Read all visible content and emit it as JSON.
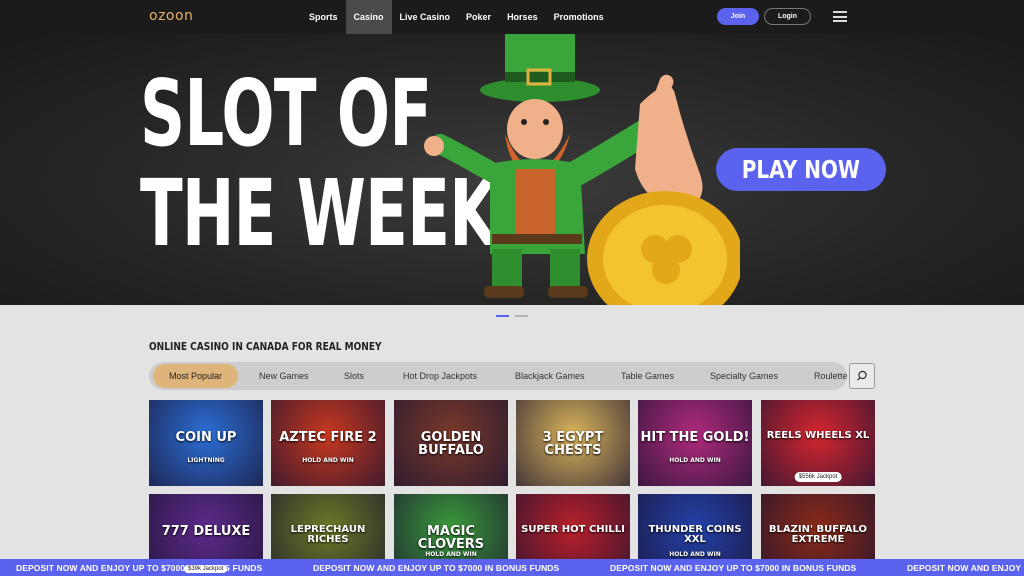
{
  "header": {
    "logo": "ozoon",
    "nav": [
      "Sports",
      "Casino",
      "Live Casino",
      "Poker",
      "Horses",
      "Promotions"
    ],
    "active_nav": "Casino",
    "join_label": "Join",
    "login_label": "Login",
    "menu_icon": "hamburger-icon"
  },
  "hero": {
    "title_line1": "SLOT OF",
    "title_line2": "THE WEEK",
    "cta_label": "PLAY NOW",
    "slides": 2,
    "active_slide": 1
  },
  "section": {
    "title": "ONLINE CASINO IN CANADA FOR REAL MONEY",
    "tabs": [
      "Most Popular",
      "New Games",
      "Slots",
      "Hot Drop Jackpots",
      "Blackjack Games",
      "Table Games",
      "Specialty Games",
      "Roulette"
    ],
    "active_tab": "Most Popular",
    "search_icon": "search-icon"
  },
  "games": [
    {
      "title": "COIN UP",
      "sub": "LIGHTNING",
      "color": "#2b6fd6"
    },
    {
      "title": "AZTEC FIRE 2",
      "sub": "HOLD AND WIN",
      "color": "#c8381f"
    },
    {
      "title": "GOLDEN BUFFALO",
      "sub": "",
      "color": "#7a3a2a"
    },
    {
      "title": "3 EGYPT CHESTS",
      "sub": "",
      "color": "#d9b45a"
    },
    {
      "title": "HIT THE GOLD!",
      "sub": "HOLD AND WIN",
      "color": "#b02a7c"
    },
    {
      "title": "REELS WHEELS XL",
      "sub": "",
      "color": "#d4262f",
      "jackpot": "$556k Jackpot"
    },
    {
      "title": "777 DELUXE",
      "sub": "",
      "color": "#5d2a8a",
      "jackpot": "$39k Jackpot"
    },
    {
      "title": "LEPRECHAUN RICHES",
      "sub": "",
      "color": "#6a7a25"
    },
    {
      "title": "MAGIC CLOVERS",
      "sub": "HOLD AND WIN",
      "color": "#3a9a3a"
    },
    {
      "title": "SUPER HOT CHILLI",
      "sub": "",
      "color": "#b8202a"
    },
    {
      "title": "THUNDER COINS XXL",
      "sub": "HOLD AND WIN",
      "color": "#2341a8"
    },
    {
      "title": "BLAZIN' BUFFALO EXTREME",
      "sub": "",
      "color": "#8a2a18"
    }
  ],
  "ticker": {
    "message": "DEPOSIT NOW AND ENJOY UP TO $7000 IN BONUS FUNDS"
  },
  "colors": {
    "accent": "#5b63ee",
    "tab_active": "#deb47a",
    "header_bg": "#1b1b1b"
  }
}
